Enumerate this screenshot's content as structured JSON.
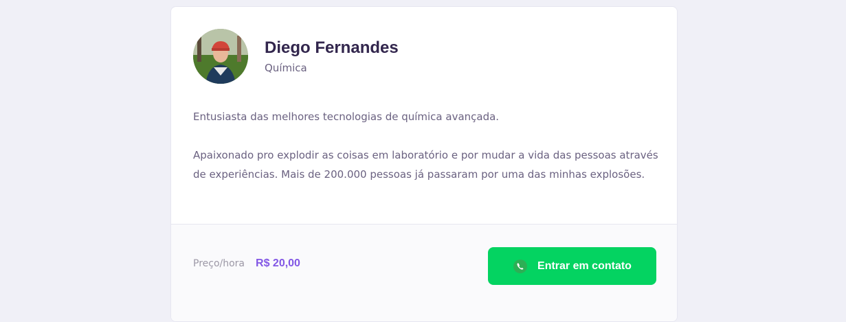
{
  "teacher": {
    "name": "Diego Fernandes",
    "subject": "Química",
    "avatar_icon": "avatar-photo"
  },
  "bio": {
    "paragraphs": [
      "Entusiasta das melhores tecnologias de química avançada.",
      "Apaixonado pro explodir as coisas em laboratório e por mudar a vida das pessoas através de experiências. Mais de 200.000 pessoas já passaram por uma das minhas explosões."
    ]
  },
  "footer": {
    "price_label": "Preço/hora",
    "price_value": "R$ 20,00",
    "contact_label": "Entrar em contato",
    "contact_icon": "whatsapp-icon"
  },
  "colors": {
    "background": "#f0f0f7",
    "title": "#32264d",
    "text": "#6a6180",
    "price": "#8257e5",
    "button": "#04d361"
  }
}
